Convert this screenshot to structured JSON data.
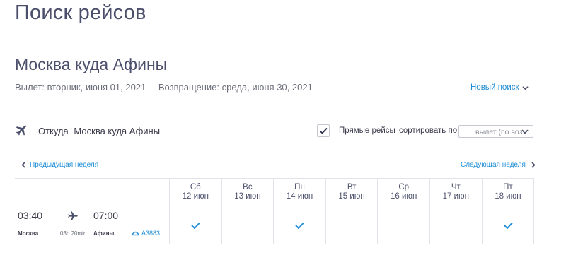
{
  "page": {
    "title": "Поиск рейсов"
  },
  "search": {
    "route_title": "Москва куда Афины",
    "departure": "Вылет: вторник, июня 01, 2021",
    "return": "Возвращение: среда, июня 30, 2021",
    "new_search_label": "Новый поиск"
  },
  "filter": {
    "from_label": "Откуда",
    "route_label": "Москва куда Афины",
    "direct_label": "Прямые рейсы",
    "direct_checked": true,
    "sort_label": "сортировать по",
    "sort_value": "вылет (по воз..."
  },
  "week_nav": {
    "prev_label": "Предыдущая неделя",
    "next_label": "Следующая неделя"
  },
  "days": [
    {
      "name": "Сб",
      "date": "12 июн",
      "available": true
    },
    {
      "name": "Вс",
      "date": "13 июн",
      "available": false
    },
    {
      "name": "Пн",
      "date": "14 июн",
      "available": true
    },
    {
      "name": "Вт",
      "date": "15 июн",
      "available": false
    },
    {
      "name": "Ср",
      "date": "16 июн",
      "available": false
    },
    {
      "name": "Чт",
      "date": "17 июн",
      "available": false
    },
    {
      "name": "Пт",
      "date": "18 июн",
      "available": true
    }
  ],
  "flight": {
    "dep_time": "03:40",
    "arr_time": "07:00",
    "dep_city": "Москва",
    "duration": "03h 20min",
    "arr_city": "Афины",
    "aircraft": "A3883"
  },
  "colors": {
    "accent": "#1f8dd6",
    "title": "#4b4f6b",
    "icon": "#4b4f6b"
  },
  "icons": {
    "plane": "plane-icon",
    "check": "check-icon",
    "chevron": "chevron-icon",
    "aircraft": "aircraft-icon"
  }
}
